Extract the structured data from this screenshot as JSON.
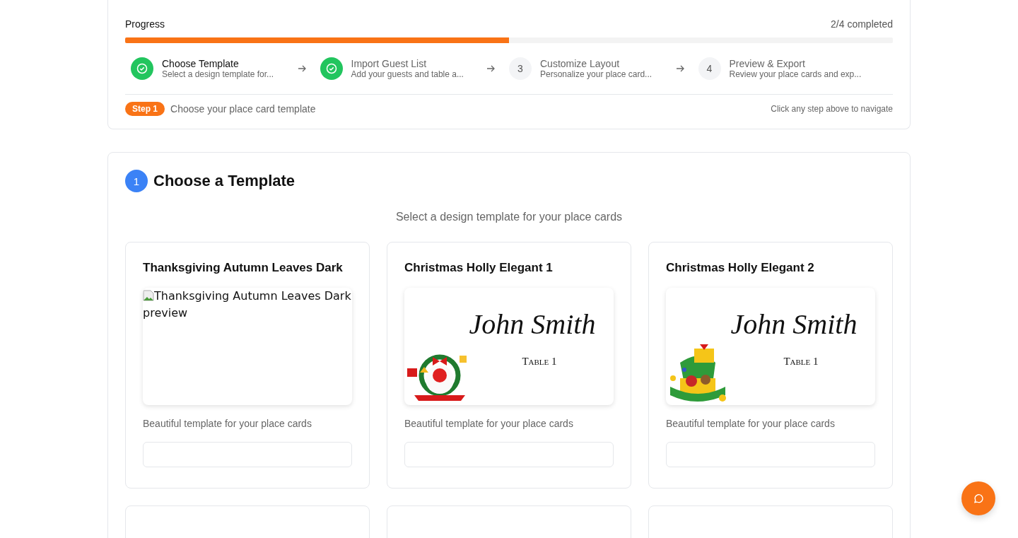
{
  "progress": {
    "title": "Progress",
    "count": "2/4 completed",
    "level": 0.5,
    "steps": [
      {
        "title": "Choose Template",
        "subtitle": "Select a design template for...",
        "completed": true,
        "selected": true
      },
      {
        "title": "Import Guest List",
        "subtitle": "Add your guests and table a...",
        "completed": true,
        "selected": false
      },
      {
        "number": "3",
        "title": "Customize Layout",
        "subtitle": "Personalize your place card...",
        "completed": false,
        "selected": false
      },
      {
        "number": "4",
        "title": "Preview & Export",
        "subtitle": "Review your place cards and exp...",
        "completed": false,
        "selected": false
      }
    ],
    "current_badge": "Step 1",
    "current_text": "Choose your place card template",
    "hint": "Click any step above to navigate"
  },
  "section": {
    "number": "1",
    "title": "Choose a Template",
    "subtitle": "Select a design template for your place cards",
    "templates": [
      {
        "name": "Thanksgiving Autumn Leaves Dark",
        "kind": "broken",
        "alt": "Thanksgiving Autumn Leaves Dark preview",
        "description": "Beautiful template for your place cards"
      },
      {
        "name": "Christmas Holly Elegant 1",
        "kind": "wreath",
        "guest": "John Smith",
        "table": "Table 1",
        "description": "Beautiful template for your place cards"
      },
      {
        "name": "Christmas Holly Elegant 2",
        "kind": "gift",
        "guest": "John Smith",
        "table": "Table 1",
        "description": "Beautiful template for your place cards"
      },
      {
        "kind": "empty"
      },
      {
        "kind": "empty"
      },
      {
        "kind": "empty"
      }
    ]
  }
}
